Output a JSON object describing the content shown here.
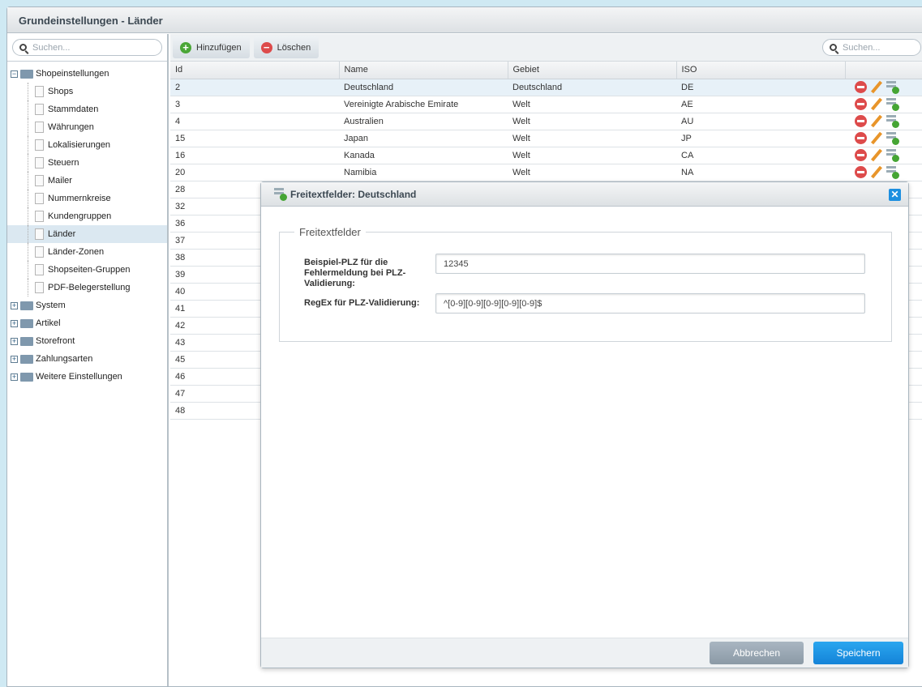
{
  "window": {
    "title": "Grundeinstellungen - Länder"
  },
  "sidebar": {
    "search_placeholder": "Suchen...",
    "items": [
      {
        "label": "Shopeinstellungen",
        "type": "folder",
        "expanded": true
      },
      {
        "label": "Shops",
        "type": "leaf"
      },
      {
        "label": "Stammdaten",
        "type": "leaf"
      },
      {
        "label": "Währungen",
        "type": "leaf"
      },
      {
        "label": "Lokalisierungen",
        "type": "leaf"
      },
      {
        "label": "Steuern",
        "type": "leaf"
      },
      {
        "label": "Mailer",
        "type": "leaf"
      },
      {
        "label": "Nummernkreise",
        "type": "leaf"
      },
      {
        "label": "Kundengruppen",
        "type": "leaf"
      },
      {
        "label": "Länder",
        "type": "leaf",
        "selected": true
      },
      {
        "label": "Länder-Zonen",
        "type": "leaf"
      },
      {
        "label": "Shopseiten-Gruppen",
        "type": "leaf"
      },
      {
        "label": "PDF-Belegerstellung",
        "type": "leaf"
      },
      {
        "label": "System",
        "type": "folder"
      },
      {
        "label": "Artikel",
        "type": "folder"
      },
      {
        "label": "Storefront",
        "type": "folder"
      },
      {
        "label": "Zahlungsarten",
        "type": "folder"
      },
      {
        "label": "Weitere Einstellungen",
        "type": "folder"
      }
    ]
  },
  "toolbar": {
    "add_label": "Hinzufügen",
    "delete_label": "Löschen",
    "search_placeholder": "Suchen..."
  },
  "grid": {
    "columns": [
      "Id",
      "Name",
      "Gebiet",
      "ISO"
    ],
    "rows": [
      [
        "2",
        "Deutschland",
        "Deutschland",
        "DE"
      ],
      [
        "3",
        "Vereinigte Arabische Emirate",
        "Welt",
        "AE"
      ],
      [
        "4",
        "Australien",
        "Welt",
        "AU"
      ],
      [
        "15",
        "Japan",
        "Welt",
        "JP"
      ],
      [
        "16",
        "Kanada",
        "Welt",
        "CA"
      ],
      [
        "20",
        "Namibia",
        "Welt",
        "NA"
      ],
      [
        "28",
        "",
        "",
        ""
      ],
      [
        "32",
        "",
        "",
        ""
      ],
      [
        "36",
        "",
        "",
        ""
      ],
      [
        "37",
        "",
        "",
        ""
      ],
      [
        "38",
        "",
        "",
        ""
      ],
      [
        "39",
        "",
        "",
        ""
      ],
      [
        "40",
        "",
        "",
        ""
      ],
      [
        "41",
        "",
        "",
        ""
      ],
      [
        "42",
        "",
        "",
        ""
      ],
      [
        "43",
        "",
        "",
        ""
      ],
      [
        "45",
        "",
        "",
        ""
      ],
      [
        "46",
        "",
        "",
        ""
      ],
      [
        "47",
        "",
        "",
        ""
      ],
      [
        "48",
        "",
        "",
        ""
      ]
    ]
  },
  "dialog": {
    "title": "Freitextfelder: Deutschland",
    "fieldset": "Freitextfelder",
    "fields": [
      {
        "label": "Beispiel-PLZ für die Fehlermeldung bei PLZ-Validierung:",
        "value": "12345"
      },
      {
        "label": "RegEx für PLZ-Validierung:",
        "value": "^[0-9][0-9][0-9][0-9][0-9]$"
      }
    ],
    "cancel_label": "Abbrechen",
    "save_label": "Speichern"
  },
  "colors": {
    "accent": "#1d8fe0",
    "selected_row": "#e7f1f8"
  }
}
